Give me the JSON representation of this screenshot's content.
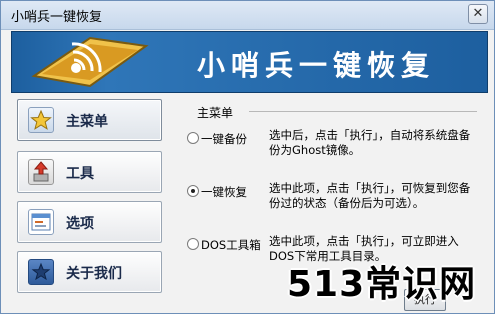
{
  "window": {
    "title": "小哨兵一键恢复",
    "close_glyph": "✕"
  },
  "banner": {
    "title": "小哨兵一键恢复"
  },
  "nav": [
    {
      "label": "主菜单",
      "icon": "star-icon"
    },
    {
      "label": "工具",
      "icon": "restore-arrow-icon"
    },
    {
      "label": "选项",
      "icon": "options-window-icon"
    },
    {
      "label": "关于我们",
      "icon": "info-star-icon"
    }
  ],
  "main": {
    "group_title": "主菜单",
    "options": [
      {
        "name": "一键备份",
        "selected": false,
        "desc": "选中后，点击「执行」，自动将系统盘备份为Ghost镜像。"
      },
      {
        "name": "一键恢复",
        "selected": true,
        "desc": "选中此项，点击「执行」，可恢复到您备份过的状态（备份后为可选）。"
      },
      {
        "name": "DOS工具箱",
        "selected": false,
        "desc": "选中此项，点击「执行」，可立即进入DOS下常用工具目录。"
      }
    ],
    "execute_label": "执行"
  },
  "watermark": {
    "text": "513常识网"
  },
  "colors": {
    "banner_blue": "#1d5f9f",
    "window_bg": "#f2f2f2"
  }
}
